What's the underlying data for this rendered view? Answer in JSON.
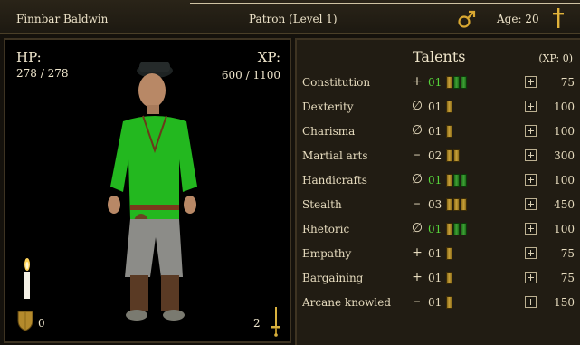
{
  "topbar": {
    "character_name": "Finnbar Baldwin",
    "title": "Patron (Level 1)",
    "gender_icon": "male-symbol-icon",
    "age": "Age: 20",
    "faith_icon": "cross-icon"
  },
  "stats": {
    "hp_label": "HP:",
    "hp_value": "278 / 278",
    "xp_label": "XP:",
    "xp_value": "600 / 1100",
    "armor_value": "0",
    "weapon_value": "2"
  },
  "talents": {
    "header": "Talents",
    "xp_available": "(XP: 0)",
    "rows": [
      {
        "name": "Constitution",
        "symbol": "+",
        "level": "01",
        "highlight": true,
        "bars": 3,
        "green_bars": 2,
        "cost": "75"
      },
      {
        "name": "Dexterity",
        "symbol": "∅",
        "level": "01",
        "highlight": false,
        "bars": 1,
        "green_bars": 0,
        "cost": "100"
      },
      {
        "name": "Charisma",
        "symbol": "∅",
        "level": "01",
        "highlight": false,
        "bars": 1,
        "green_bars": 0,
        "cost": "100"
      },
      {
        "name": "Martial arts",
        "symbol": "–",
        "level": "02",
        "highlight": false,
        "bars": 2,
        "green_bars": 0,
        "cost": "300"
      },
      {
        "name": "Handicrafts",
        "symbol": "∅",
        "level": "01",
        "highlight": true,
        "bars": 3,
        "green_bars": 2,
        "cost": "100"
      },
      {
        "name": "Stealth",
        "symbol": "–",
        "level": "03",
        "highlight": false,
        "bars": 3,
        "green_bars": 0,
        "cost": "450"
      },
      {
        "name": "Rhetoric",
        "symbol": "∅",
        "level": "01",
        "highlight": true,
        "bars": 3,
        "green_bars": 2,
        "cost": "100"
      },
      {
        "name": "Empathy",
        "symbol": "+",
        "level": "01",
        "highlight": false,
        "bars": 1,
        "green_bars": 0,
        "cost": "75"
      },
      {
        "name": "Bargaining",
        "symbol": "+",
        "level": "01",
        "highlight": false,
        "bars": 1,
        "green_bars": 0,
        "cost": "75"
      },
      {
        "name": "Arcane knowled",
        "symbol": "–",
        "level": "01",
        "highlight": false,
        "bars": 1,
        "green_bars": 0,
        "cost": "150"
      }
    ]
  },
  "colors": {
    "accent_green": "#56d43a",
    "bar_gold": "#c9a23a",
    "bar_green": "#3ea235"
  }
}
